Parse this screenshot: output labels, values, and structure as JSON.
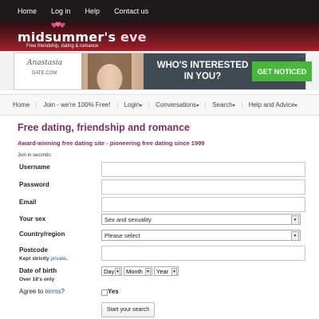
{
  "topnav": [
    "Home",
    "Log in",
    "Help",
    "Contact us"
  ],
  "brand": {
    "name_part1": "midsummer's",
    "name_part2": " eve",
    "tagline": "Free friendship, dating & romance",
    "accent": "#a81f2b"
  },
  "ad": {
    "brand_line1": "Anastasia",
    "brand_line2": "DATE.COM",
    "headline": "WHO'S INTERESTED IN YOU?",
    "cta": "GET NOTICED",
    "cta_color": "#48b83b"
  },
  "mainnav": [
    {
      "label": "Home",
      "dropdown": false
    },
    {
      "label": "Join - we're 100% Free!",
      "dropdown": false
    },
    {
      "label": "Login",
      "dropdown": true
    },
    {
      "label": "Conversations",
      "dropdown": true
    },
    {
      "label": "Search",
      "dropdown": true
    },
    {
      "label": "Help and Advice",
      "dropdown": true
    }
  ],
  "form": {
    "title": "Free dating, friendship and romance",
    "subtitle": "Award-winning free dating site - pioneering free dating since 1999",
    "join_seconds": "Join in seconds:",
    "username_label": "Username",
    "password_label": "Password",
    "email_label": "Email",
    "sex_label": "Your sex",
    "sex_value": "Sex and sexuality",
    "country_label": "Country/region",
    "country_value": "Please select",
    "postcode_label": "Postcode",
    "postcode_note_prefix": "Kept strictly ",
    "postcode_note_link": "private",
    "postcode_note_suffix": ".",
    "dob_label": "Date of birth",
    "dob_note": "Over 18's only",
    "dob_day": "Day",
    "dob_month": "Month",
    "dob_year": "Year",
    "agree_prefix": "Agree to ",
    "agree_link": "terms",
    "agree_suffix": "?",
    "yes_label": "Yes",
    "submit": "Start your search",
    "title_color": "#7a2f62",
    "link_color": "#1d57b2"
  },
  "icons": {
    "logo": "butterfly-hearts-icon",
    "dropdown": "caret-down-icon",
    "ad_close": "ad-choices-icon"
  }
}
